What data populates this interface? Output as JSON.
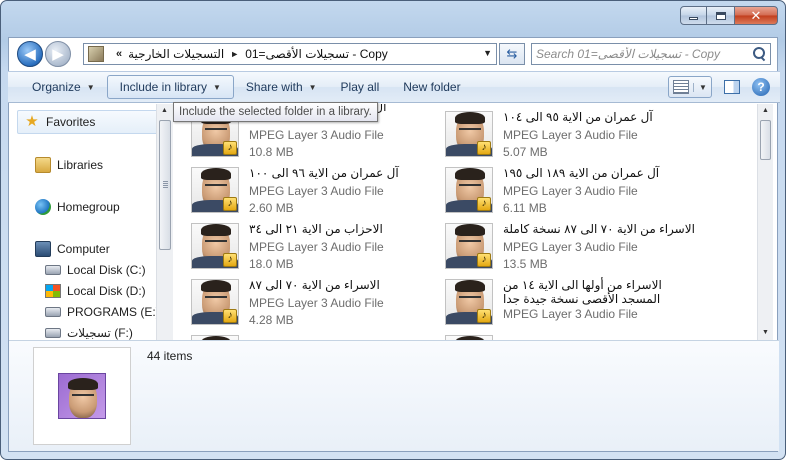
{
  "window": {
    "controls": {
      "minimize": "minimize",
      "maximize": "maximize",
      "close": "close"
    }
  },
  "address_bar": {
    "overflow": "«",
    "segments": [
      "التسجيلات الخارجية",
      "تسجيلات الأقصى=01 - Copy"
    ],
    "separator": "►"
  },
  "search": {
    "placeholder": "Search تسجيلات الأقصى=01 - Copy"
  },
  "toolbar": {
    "organize": "Organize",
    "include_in_library": "Include in library",
    "share_with": "Share with",
    "play_all": "Play all",
    "new_folder": "New folder"
  },
  "tooltip": "Include the selected folder in a library.",
  "nav": {
    "favorites": "Favorites",
    "libraries": "Libraries",
    "homegroup": "Homegroup",
    "computer": "Computer",
    "drives": [
      {
        "label": "Local Disk (C:)",
        "icon": "disk-icon"
      },
      {
        "label": "Local Disk (D:)",
        "icon": "windows-disk-icon"
      },
      {
        "label": "PROGRAMS (E:)",
        "icon": "disk-icon"
      },
      {
        "label": "تسجيلات (F:)",
        "icon": "disk-icon"
      }
    ]
  },
  "files": [
    {
      "name": "آل عمران من الاية ... الى ...",
      "type": "MPEG Layer 3 Audio File",
      "size": "10.8 MB"
    },
    {
      "name": "آل عمران من الاية ٩٥ الى ١٠٤",
      "type": "MPEG Layer 3 Audio File",
      "size": "5.07 MB"
    },
    {
      "name": "آل عمران من الاية ٩٦ الى ١٠٠",
      "type": "MPEG Layer 3 Audio File",
      "size": "2.60 MB"
    },
    {
      "name": "آل عمران من الاية ١٨٩ الى ١٩٥",
      "type": "MPEG Layer 3 Audio File",
      "size": "6.11 MB"
    },
    {
      "name": "الاحزاب من الاية ٢١ الى ٣٤",
      "type": "MPEG Layer 3 Audio File",
      "size": "18.0 MB"
    },
    {
      "name": "الاسراء من الاية ٧٠ الى ٨٧ نسخة كاملة",
      "type": "MPEG Layer 3 Audio File",
      "size": "13.5 MB"
    },
    {
      "name": "الاسراء من الاية ٧٠ الى ٨٧",
      "type": "MPEG Layer 3 Audio File",
      "size": "4.28 MB"
    },
    {
      "name": "الاسراء من أولها الى الاية ١٤ من المسجد الأقصى نسخة جيدة جدا",
      "type": "MPEG Layer 3 Audio File",
      "size": ""
    }
  ],
  "details": {
    "count": "44 items"
  }
}
